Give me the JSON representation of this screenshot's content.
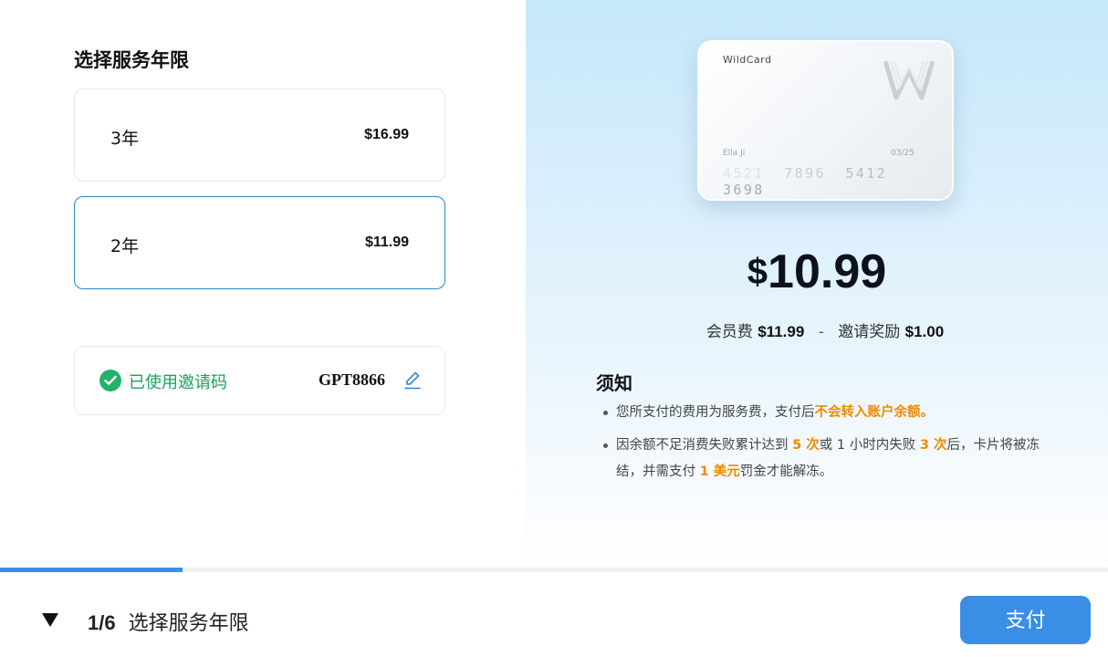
{
  "left": {
    "section_title": "选择服务年限",
    "plans": [
      {
        "label": "3年",
        "price": "$16.99",
        "selected": false
      },
      {
        "label": "2年",
        "price": "$11.99",
        "selected": true
      }
    ],
    "invite": {
      "status_label": "已使用邀请码",
      "code": "GPT8866",
      "icons": {
        "status": "check-circle-icon",
        "edit": "pencil-icon"
      }
    }
  },
  "card": {
    "brand": "WildCard",
    "holder": "Ella Ji",
    "expiry": "03/25",
    "number_groups": [
      "4521",
      "7896",
      "5412",
      "3698"
    ]
  },
  "price": {
    "currency": "$",
    "amount": "10.99",
    "fee_label": "会员费",
    "fee_value": "$11.99",
    "separator": "-",
    "reward_label": "邀请奖励",
    "reward_value": "$1.00"
  },
  "notice": {
    "title": "须知",
    "item1": {
      "text": "您所支付的费用为服务费，支付后",
      "highlight": "不会转入账户余额。"
    },
    "item2": {
      "p1": "因余额不足消费失败累计达到 ",
      "h1": "5 次",
      "p2": "或 1 小时内失败 ",
      "h2": "3 次",
      "p3": "后，卡片将被冻结，并需支付 ",
      "h3": "1 美元",
      "p4": "罚金才能解冻。"
    }
  },
  "progress": {
    "step": 1,
    "total": 6,
    "fraction": 0.1647
  },
  "footer": {
    "step_count": "1/6",
    "step_title": "选择服务年限",
    "toggle_icon": "caret-down-icon",
    "pay_label": "支付"
  },
  "colors": {
    "accent": "#3a8ee6",
    "success": "#1fb36b",
    "highlight": "#f08a00",
    "selected_border": "#2e86c9"
  }
}
